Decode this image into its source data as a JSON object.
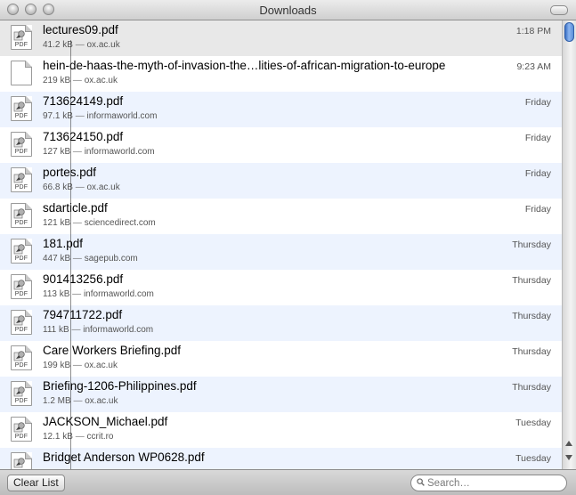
{
  "window": {
    "title": "Downloads"
  },
  "downloads": [
    {
      "name": "lectures09.pdf",
      "size": "41.2 kB",
      "source": "ox.ac.uk",
      "date": "1:18 PM",
      "type": "pdf"
    },
    {
      "name": "hein-de-haas-the-myth-of-invasion-the…lities-of-african-migration-to-europe",
      "size": "219 kB",
      "source": "ox.ac.uk",
      "date": "9:23 AM",
      "type": "generic"
    },
    {
      "name": "713624149.pdf",
      "size": "97.1 kB",
      "source": "informaworld.com",
      "date": "Friday",
      "type": "pdf"
    },
    {
      "name": "713624150.pdf",
      "size": "127 kB",
      "source": "informaworld.com",
      "date": "Friday",
      "type": "pdf"
    },
    {
      "name": "portes.pdf",
      "size": "66.8 kB",
      "source": "ox.ac.uk",
      "date": "Friday",
      "type": "pdf"
    },
    {
      "name": "sdarticle.pdf",
      "size": "121 kB",
      "source": "sciencedirect.com",
      "date": "Friday",
      "type": "pdf"
    },
    {
      "name": "181.pdf",
      "size": "447 kB",
      "source": "sagepub.com",
      "date": "Thursday",
      "type": "pdf"
    },
    {
      "name": "901413256.pdf",
      "size": "113 kB",
      "source": "informaworld.com",
      "date": "Thursday",
      "type": "pdf"
    },
    {
      "name": "794711722.pdf",
      "size": "111 kB",
      "source": "informaworld.com",
      "date": "Thursday",
      "type": "pdf"
    },
    {
      "name": "Care Workers Briefing.pdf",
      "size": "199 kB",
      "source": "ox.ac.uk",
      "date": "Thursday",
      "type": "pdf"
    },
    {
      "name": "Briefing-1206-Philippines.pdf",
      "size": "1.2 MB",
      "source": "ox.ac.uk",
      "date": "Thursday",
      "type": "pdf"
    },
    {
      "name": "JACKSON_Michael.pdf",
      "size": "12.1 kB",
      "source": "ccrit.ro",
      "date": "Tuesday",
      "type": "pdf"
    },
    {
      "name": "Bridget Anderson WP0628.pdf",
      "size": "",
      "source": "",
      "date": "Tuesday",
      "type": "pdf"
    }
  ],
  "meta_separator": "—",
  "file_icon_tag": "PDF",
  "bottom": {
    "clear_label": "Clear List",
    "search_placeholder": "Search…"
  },
  "colors": {
    "row_alt": "#edf3fe",
    "selected": "#e8e8e8",
    "thumb": "#5b8fd8"
  }
}
